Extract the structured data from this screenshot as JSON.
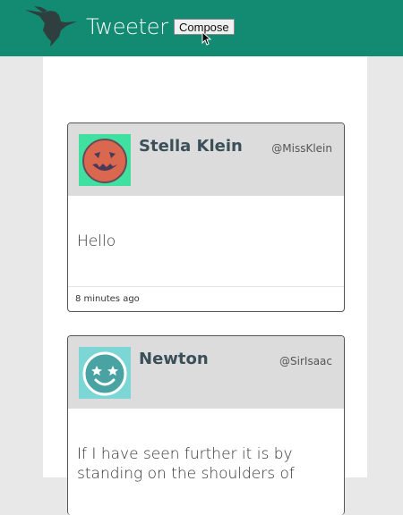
{
  "header": {
    "title": "Tweeter",
    "compose_label": "Compose",
    "logo_icon": "hummingbird-icon",
    "background_color": "#138a72"
  },
  "tweets": [
    {
      "name": "Stella Klein",
      "handle": "@MissKlein",
      "text": "Hello",
      "time": "8 minutes ago",
      "avatar_icon": "pumpkin-face-icon",
      "avatar_color": "#3fe0a0"
    },
    {
      "name": "Newton",
      "handle": "@SirIsaac",
      "text": "If I have seen further it is by standing on the shoulders of",
      "avatar_icon": "star-eyes-face-icon",
      "avatar_color": "#7dd6d6"
    }
  ]
}
